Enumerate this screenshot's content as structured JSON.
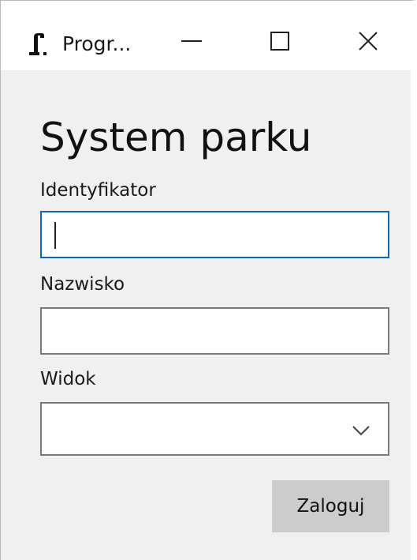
{
  "window": {
    "title": "Progr...",
    "minimize_icon": "minimize-icon",
    "maximize_icon": "maximize-icon",
    "close_icon": "close-icon",
    "app_icon": "app-icon"
  },
  "form": {
    "heading": "System parku",
    "id_label": "Identyfikator",
    "id_value": "",
    "name_label": "Nazwisko",
    "name_value": "",
    "view_label": "Widok",
    "view_selected": "",
    "login_button": "Zaloguj"
  },
  "colors": {
    "focus_border": "#0f67b3",
    "window_bg": "#f0f0f0",
    "button_bg": "#cccccc"
  }
}
